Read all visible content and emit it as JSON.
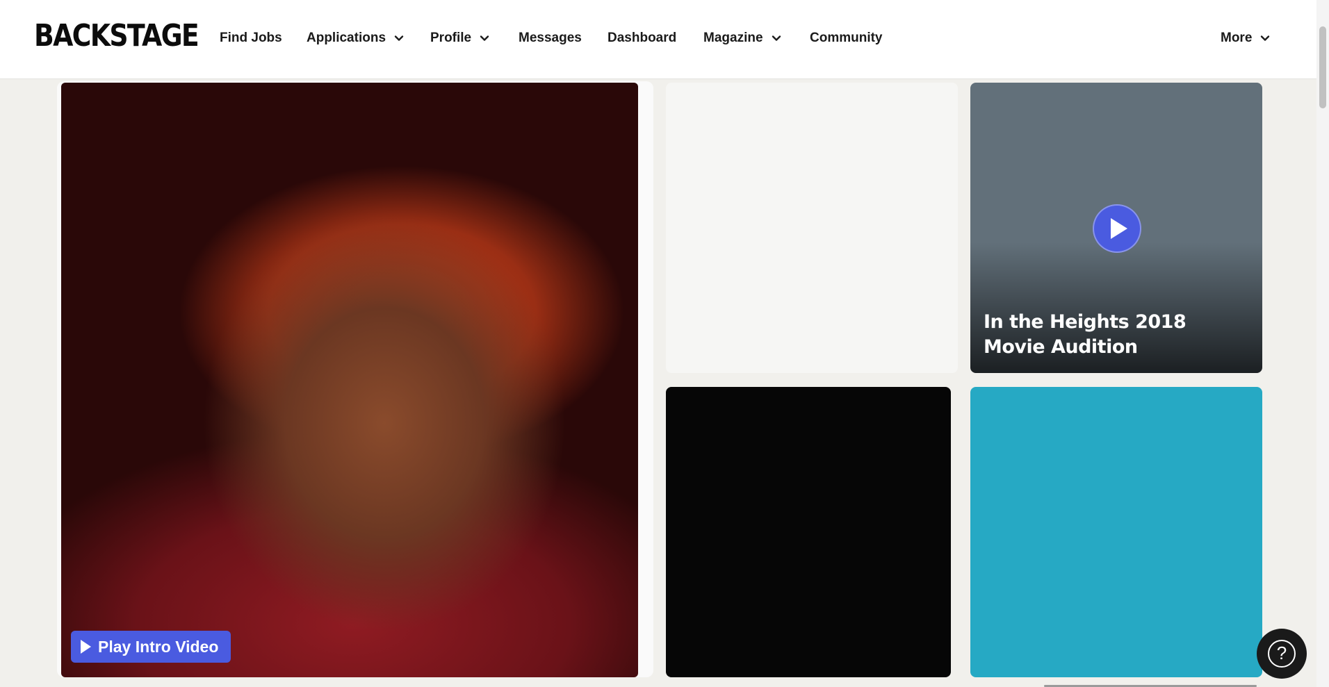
{
  "nav": {
    "logo": "BACKSTAGE",
    "items": [
      {
        "label": "Find Jobs",
        "dropdown": false
      },
      {
        "label": "Applications",
        "dropdown": true
      },
      {
        "label": "Profile",
        "dropdown": true
      },
      {
        "label": "Messages",
        "dropdown": false
      },
      {
        "label": "Dashboard",
        "dropdown": false
      },
      {
        "label": "Magazine",
        "dropdown": true
      },
      {
        "label": "Community",
        "dropdown": false
      }
    ],
    "more": "More"
  },
  "gallery": {
    "hero_button": "Play Intro Video",
    "video_caption": "In the Heights 2018 Movie Audition"
  },
  "icons": {
    "chevron": "chevron-down-icon",
    "play": "play-icon",
    "help": "help-icon"
  },
  "colors": {
    "accent": "#4a5be0",
    "page_bg": "#f1f0ec",
    "nav_bg": "#ffffff"
  }
}
